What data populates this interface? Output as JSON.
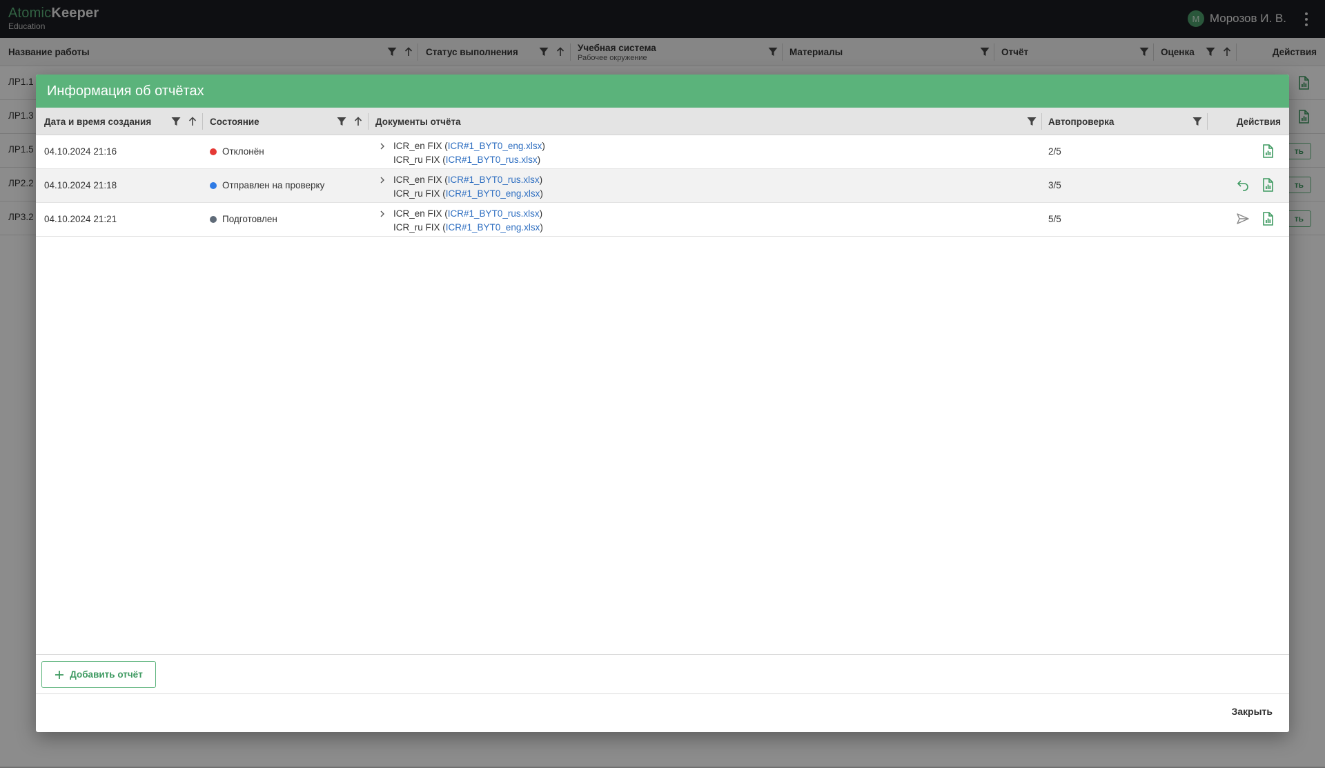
{
  "app": {
    "brand_part1": "Atomic",
    "brand_part2": "Keeper",
    "subtitle": "Education",
    "user_initial": "М",
    "user_name": "Морозов И. В."
  },
  "background_table": {
    "columns": {
      "name": "Название работы",
      "status": "Статус выполнения",
      "system": "Учебная система",
      "system_sub": "Рабочее окружение",
      "materials": "Материалы",
      "report": "Отчёт",
      "grade": "Оценка",
      "actions": "Действия"
    },
    "rows": [
      {
        "name": "ЛР1.1",
        "action": ""
      },
      {
        "name": "ЛР1.3",
        "action": ""
      },
      {
        "name": "ЛР1.5",
        "action": "ть"
      },
      {
        "name": "ЛР2.2",
        "action": "ть"
      },
      {
        "name": "ЛР3.2",
        "action": "ть"
      }
    ]
  },
  "dialog": {
    "title": "Информация об отчётах",
    "columns": {
      "created": "Дата и время создания",
      "state": "Состояние",
      "documents": "Документы отчёта",
      "autocheck": "Автопроверка",
      "actions": "Действия"
    },
    "rows": [
      {
        "created": "04.10.2024 21:16",
        "state": "Отклонён",
        "doc1_label": "ICR_en FIX (",
        "doc1_file": "ICR#1_BYT0_eng.xlsx",
        "doc2_label": "ICR_ru FIX (",
        "doc2_file": "ICR#1_BYT0_rus.xlsx",
        "autocheck": "2/5"
      },
      {
        "created": "04.10.2024 21:18",
        "state": "Отправлен на проверку",
        "doc1_label": "ICR_en FIX (",
        "doc1_file": "ICR#1_BYT0_rus.xlsx",
        "doc2_label": "ICR_ru FIX (",
        "doc2_file": "ICR#1_BYT0_eng.xlsx",
        "autocheck": "3/5"
      },
      {
        "created": "04.10.2024 21:21",
        "state": "Подготовлен",
        "doc1_label": "ICR_en FIX (",
        "doc1_file": "ICR#1_BYT0_rus.xlsx",
        "doc2_label": "ICR_ru FIX (",
        "doc2_file": "ICR#1_BYT0_eng.xlsx",
        "autocheck": "5/5"
      }
    ],
    "paren_close": ")",
    "add_report_label": "Добавить отчёт",
    "close_label": "Закрыть"
  },
  "colors": {
    "accent": "#5bb37b",
    "state_rejected": "#e53935",
    "state_sent": "#2f7be5",
    "state_prepared": "#5f6b78",
    "link": "#2f6fc1"
  },
  "icons": {
    "filter": "filter-icon",
    "sort": "sort-up-icon",
    "expand": "chevron-right-icon",
    "report_file": "spreadsheet-file-icon",
    "revert": "undo-arrow-icon",
    "send": "send-icon",
    "add": "plus-icon",
    "menu": "kebab-menu-icon"
  }
}
